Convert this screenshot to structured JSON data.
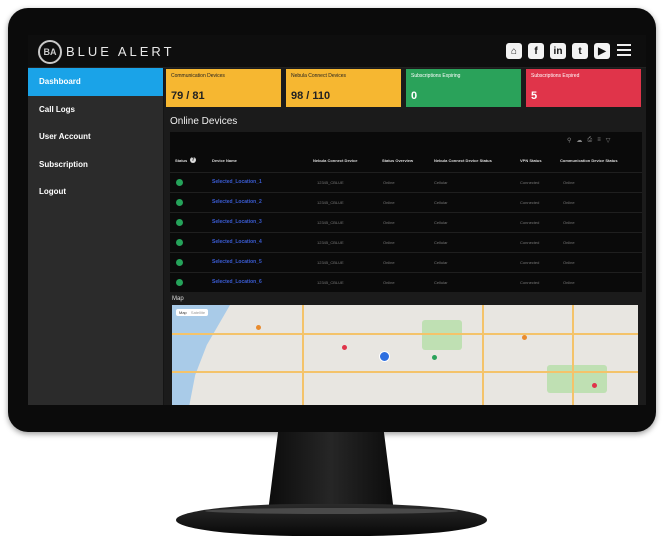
{
  "brand": {
    "name": "BLUE ALERT",
    "logo_text": "BA"
  },
  "header": {
    "icons": [
      "home-icon",
      "facebook-icon",
      "linkedin-icon",
      "twitter-icon",
      "youtube-icon",
      "menu-icon"
    ]
  },
  "sidebar": {
    "items": [
      {
        "label": "Dashboard",
        "active": true
      },
      {
        "label": "Call Logs"
      },
      {
        "label": "User Account"
      },
      {
        "label": "Subscription"
      },
      {
        "label": "Logout"
      }
    ]
  },
  "cards": [
    {
      "label": "Communication Devices",
      "value": "79 / 81",
      "color": "#f6b731"
    },
    {
      "label": "Nebula Connect Devices",
      "value": "98 / 110",
      "color": "#f6b731"
    },
    {
      "label": "Subscriptions Expiring",
      "value": "0",
      "color": "#2aa25a"
    },
    {
      "label": "Subscriptions Expired",
      "value": "5",
      "color": "#e0344a"
    }
  ],
  "online_devices": {
    "title": "Online Devices",
    "columns": [
      "Status",
      "Device Name",
      "Nebula Connect Device",
      "Status Overview",
      "Nebula Connect Device Status",
      "VPN Status",
      "Communication Device Status"
    ],
    "rows": [
      {
        "name": "Selected_Location_1",
        "device": "12345_CBLUE",
        "overview": "Online",
        "nebula_status": "Cellular",
        "vpn": "Connected",
        "comm": "Online"
      },
      {
        "name": "Selected_Location_2",
        "device": "12345_CBLUE",
        "overview": "Online",
        "nebula_status": "Cellular",
        "vpn": "Connected",
        "comm": "Online"
      },
      {
        "name": "Selected_Location_3",
        "device": "12345_CBLUE",
        "overview": "Online",
        "nebula_status": "Cellular",
        "vpn": "Connected",
        "comm": "Online"
      },
      {
        "name": "Selected_Location_4",
        "device": "12345_CBLUE",
        "overview": "Online",
        "nebula_status": "Cellular",
        "vpn": "Connected",
        "comm": "Online"
      },
      {
        "name": "Selected_Location_5",
        "device": "12345_CBLUE",
        "overview": "Online",
        "nebula_status": "Cellular",
        "vpn": "Connected",
        "comm": "Online"
      },
      {
        "name": "Selected_Location_6",
        "device": "12345_CBLUE",
        "overview": "Online",
        "nebula_status": "Cellular",
        "vpn": "Connected",
        "comm": "Online"
      }
    ]
  },
  "map": {
    "title": "Map",
    "tabs": [
      "Map",
      "Satellite"
    ]
  }
}
